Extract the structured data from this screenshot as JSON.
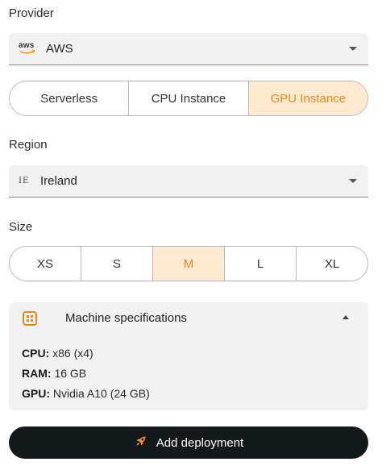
{
  "provider": {
    "label": "Provider",
    "logo_text": "aws",
    "selected": "AWS"
  },
  "type_selector": {
    "options": [
      "Serverless",
      "CPU Instance",
      "GPU Instance"
    ],
    "active": "GPU Instance"
  },
  "region": {
    "label": "Region",
    "code": "IE",
    "selected": "Ireland"
  },
  "size": {
    "label": "Size",
    "options": [
      "XS",
      "S",
      "M",
      "L",
      "XL"
    ],
    "active": "M"
  },
  "specs": {
    "title": "Machine specifications",
    "icon": "chip-icon",
    "rows": [
      {
        "key": "CPU:",
        "value": "x86 (x4)"
      },
      {
        "key": "RAM:",
        "value": "16 GB"
      },
      {
        "key": "GPU:",
        "value": "Nvidia A10 (24 GB)"
      }
    ]
  },
  "deploy": {
    "label": "Add deployment",
    "icon": "rocket-icon"
  },
  "colors": {
    "accent": "#e88a1a",
    "accent_bg": "#fde9cf",
    "button_bg": "#14191c"
  }
}
